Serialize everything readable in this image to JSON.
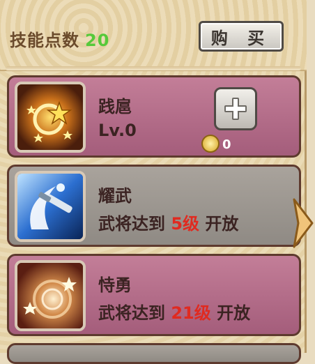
{
  "header": {
    "points_label": "技能点数",
    "points_value": "20",
    "buy_label": "购 买"
  },
  "skills": [
    {
      "name": "践扈",
      "level": "Lv.0",
      "coin": "0"
    },
    {
      "name": "耀武",
      "req_prefix": "武将达到",
      "req_level": "5级",
      "req_suffix": "开放"
    },
    {
      "name": "恃勇",
      "req_prefix": "武将达到",
      "req_level": "21级",
      "req_suffix": "开放"
    }
  ],
  "colors": {
    "points_green": "#56c93a",
    "req_red": "#e02a20",
    "card_pink": "#b36c8a",
    "card_grey": "#9d9892"
  },
  "icons": [
    "plus-icon",
    "coin-icon",
    "next-arrow-icon"
  ]
}
